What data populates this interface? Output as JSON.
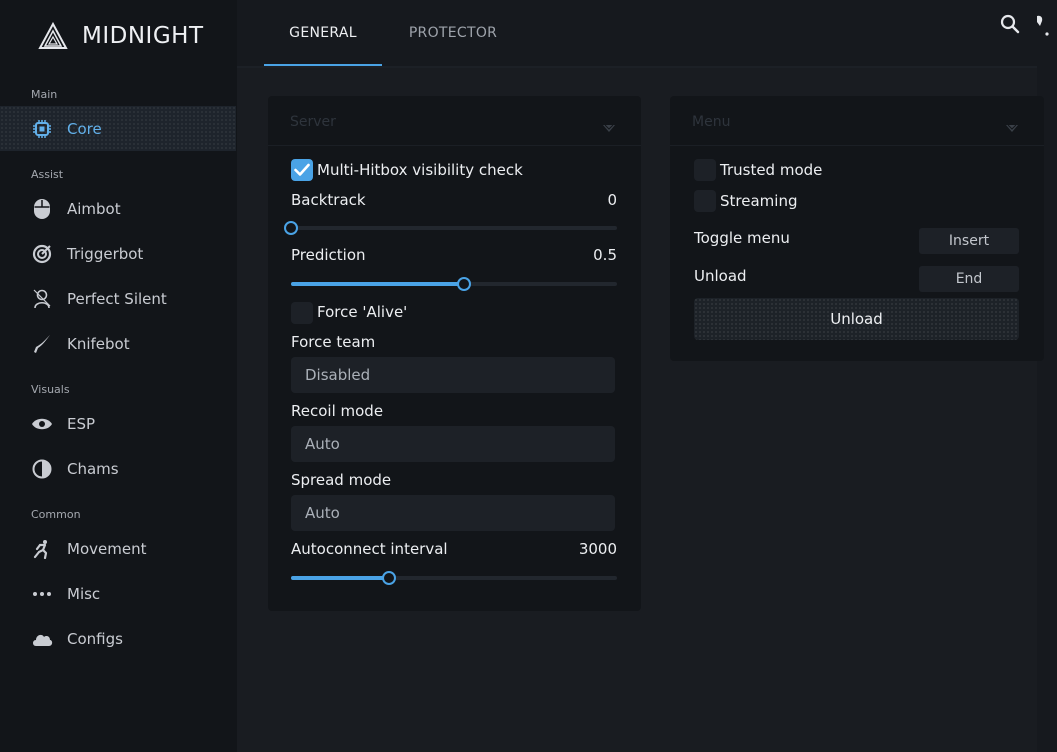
{
  "app": {
    "name": "MIDNIGHT"
  },
  "sidebar": {
    "sections": [
      {
        "label": "Main"
      },
      {
        "label": "Assist"
      },
      {
        "label": "Visuals"
      },
      {
        "label": "Common"
      }
    ],
    "items": [
      {
        "label": "Core",
        "icon": "chip-icon",
        "active": true
      },
      {
        "label": "Aimbot",
        "icon": "mouse-icon"
      },
      {
        "label": "Triggerbot",
        "icon": "target-icon"
      },
      {
        "label": "Perfect Silent",
        "icon": "ghost-icon"
      },
      {
        "label": "Knifebot",
        "icon": "knife-icon"
      },
      {
        "label": "ESP",
        "icon": "eye-icon"
      },
      {
        "label": "Chams",
        "icon": "contrast-icon"
      },
      {
        "label": "Movement",
        "icon": "running-icon"
      },
      {
        "label": "Misc",
        "icon": "more-icon"
      },
      {
        "label": "Configs",
        "icon": "cloud-icon"
      }
    ]
  },
  "tabs": [
    {
      "label": "GENERAL",
      "active": true
    },
    {
      "label": "PROTECTOR",
      "active": false
    }
  ],
  "server_panel": {
    "title": "Server",
    "multi_hitbox": {
      "label": "Multi-Hitbox visibility check",
      "checked": true
    },
    "backtrack": {
      "label": "Backtrack",
      "value": "0",
      "fraction": 0.0
    },
    "prediction": {
      "label": "Prediction",
      "value": "0.5",
      "fraction": 0.53
    },
    "force_alive": {
      "label": "Force 'Alive'",
      "checked": false
    },
    "force_team": {
      "label": "Force team",
      "value": "Disabled"
    },
    "recoil_mode": {
      "label": "Recoil mode",
      "value": "Auto"
    },
    "spread_mode": {
      "label": "Spread mode",
      "value": "Auto"
    },
    "autoconnect": {
      "label": "Autoconnect interval",
      "value": "3000",
      "fraction": 0.3
    }
  },
  "menu_panel": {
    "title": "Menu",
    "trusted_mode": {
      "label": "Trusted mode",
      "checked": false
    },
    "streaming": {
      "label": "Streaming",
      "checked": false
    },
    "toggle_menu": {
      "label": "Toggle menu",
      "key": "Insert"
    },
    "unload": {
      "label": "Unload",
      "key": "End"
    },
    "unload_button": "Unload"
  },
  "colors": {
    "accent": "#4aa3e6",
    "sidebar": "#121519",
    "background": "#191c21"
  }
}
